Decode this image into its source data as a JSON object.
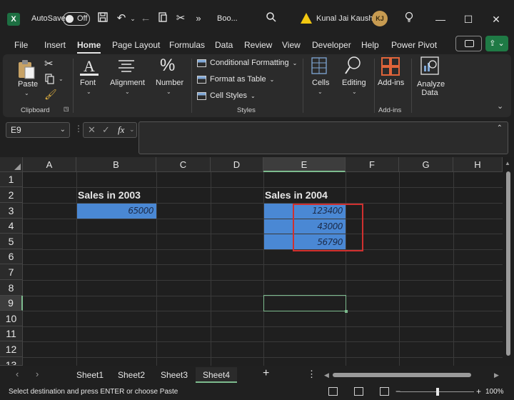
{
  "titlebar": {
    "app_logo": "X",
    "autosave_label": "AutoSave",
    "autosave_state": "Off",
    "book_title": "Boo...",
    "user_name": "Kunal Jai Kaushik",
    "user_initials": "KJ",
    "icons": [
      "save-icon",
      "undo-icon",
      "redo-icon",
      "paste-icon",
      "cut-icon",
      "more-icon",
      "search-icon",
      "warning-icon",
      "lightbulb-icon",
      "minimize-icon",
      "maximize-icon",
      "close-icon"
    ]
  },
  "menu": {
    "tabs": [
      "File",
      "Insert",
      "Home",
      "Page Layout",
      "Formulas",
      "Data",
      "Review",
      "View",
      "Developer",
      "Help",
      "Power Pivot"
    ],
    "active": "Home"
  },
  "ribbon": {
    "clipboard": {
      "paste": "Paste",
      "group": "Clipboard"
    },
    "font": {
      "label": "Font"
    },
    "alignment": {
      "label": "Alignment"
    },
    "number": {
      "label": "Number"
    },
    "styles": {
      "conditional": "Conditional Formatting",
      "format_table": "Format as Table",
      "cell_styles": "Cell Styles",
      "group": "Styles"
    },
    "cells": {
      "label": "Cells"
    },
    "editing": {
      "label": "Editing"
    },
    "addins": {
      "label": "Add-ins",
      "group": "Add-ins"
    },
    "analyze": {
      "label": "Analyze Data"
    }
  },
  "formula_bar": {
    "name_box": "E9",
    "fx": "fx",
    "value": ""
  },
  "grid": {
    "columns": [
      "A",
      "B",
      "C",
      "D",
      "E",
      "F",
      "G",
      "H"
    ],
    "selected_column": "E",
    "rows": [
      "1",
      "2",
      "3",
      "4",
      "5",
      "6",
      "7",
      "8",
      "9",
      "10",
      "11",
      "12",
      "13"
    ],
    "selected_row": "9",
    "cells": {
      "B2": "Sales in 2003",
      "E2": "Sales in 2004",
      "B3": "65000",
      "E3": "123400",
      "E4": "43000",
      "E5": "56790"
    }
  },
  "sheets": {
    "tabs": [
      "Sheet1",
      "Sheet2",
      "Sheet3",
      "Sheet4"
    ],
    "active": "Sheet4"
  },
  "status": {
    "message": "Select destination and press ENTER or choose Paste",
    "zoom": "100%"
  },
  "colors": {
    "selection_fill": "#4a88d4",
    "highlight_box": "#d0302f",
    "active_cell": "#7dbb8e"
  }
}
